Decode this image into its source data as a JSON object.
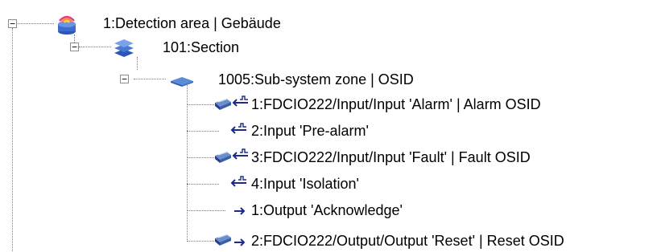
{
  "tree": {
    "root": {
      "expander": "−",
      "icon": "detection-area-icon",
      "label": "1:Detection area | Gebäude",
      "children": [
        {
          "expander": "−",
          "icon": "section-icon",
          "label": "101:Section",
          "children": [
            {
              "expander": "−",
              "icon": "subsystem-zone-icon",
              "label": "1005:Sub-system zone | OSID",
              "children": [
                {
                  "icons": [
                    "fdcio-device-icon",
                    "input-icon"
                  ],
                  "label": "1:FDCIO222/Input/Input 'Alarm' | Alarm OSID"
                },
                {
                  "icons": [
                    "input-icon"
                  ],
                  "label": "2:Input 'Pre-alarm'"
                },
                {
                  "icons": [
                    "fdcio-device-icon",
                    "input-icon"
                  ],
                  "label": "3:FDCIO222/Input/Input 'Fault' | Fault OSID"
                },
                {
                  "icons": [
                    "input-icon"
                  ],
                  "label": "4:Input 'Isolation'"
                },
                {
                  "icons": [
                    "output-arrow-icon"
                  ],
                  "label": "1:Output 'Acknowledge'"
                },
                {
                  "icons": [
                    "fdcio-device-icon",
                    "output-arrow-icon"
                  ],
                  "label": "2:FDCIO222/Output/Output 'Reset' | Reset OSID"
                }
              ]
            }
          ]
        }
      ]
    }
  },
  "colors": {
    "treeline": "#7a7a7a",
    "arrow": "#1b2a8c",
    "device": "#3a5fa8",
    "detection": "#e63c8c",
    "section": "#4a7ad0",
    "zone": "#5a8ad8"
  }
}
